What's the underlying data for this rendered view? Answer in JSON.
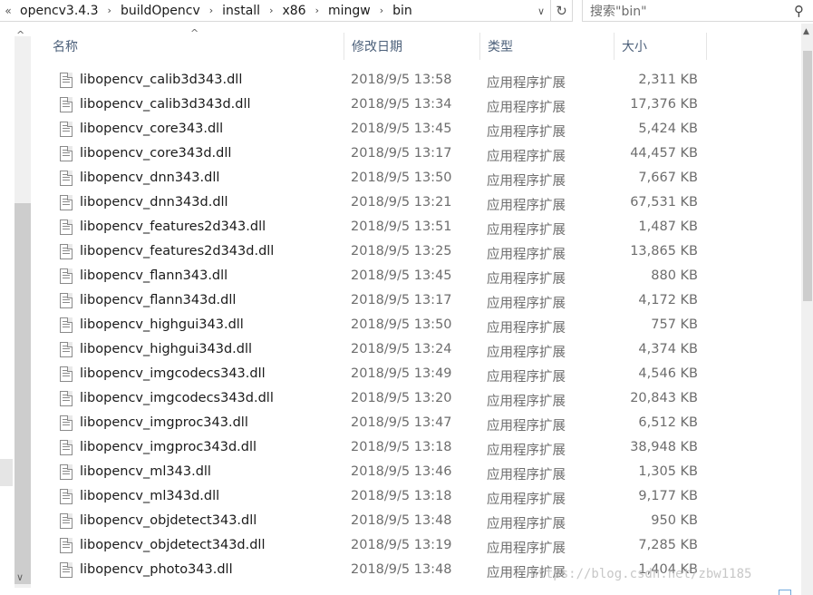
{
  "address": {
    "crumbs": [
      "opencv3.4.3",
      "buildOpencv",
      "install",
      "x86",
      "mingw",
      "bin"
    ],
    "lead_glyph": "«",
    "separator": "›",
    "dropdown_glyph": "∨",
    "refresh_glyph": "↻"
  },
  "search": {
    "placeholder": "搜索\"bin\"",
    "icon": "search-icon"
  },
  "columns": {
    "name": "名称",
    "date": "修改日期",
    "type": "类型",
    "size": "大小",
    "sort_glyph": "^"
  },
  "files": [
    {
      "name": "libopencv_calib3d343.dll",
      "date": "2018/9/5 13:58",
      "type": "应用程序扩展",
      "size": "2,311 KB"
    },
    {
      "name": "libopencv_calib3d343d.dll",
      "date": "2018/9/5 13:34",
      "type": "应用程序扩展",
      "size": "17,376 KB"
    },
    {
      "name": "libopencv_core343.dll",
      "date": "2018/9/5 13:45",
      "type": "应用程序扩展",
      "size": "5,424 KB"
    },
    {
      "name": "libopencv_core343d.dll",
      "date": "2018/9/5 13:17",
      "type": "应用程序扩展",
      "size": "44,457 KB"
    },
    {
      "name": "libopencv_dnn343.dll",
      "date": "2018/9/5 13:50",
      "type": "应用程序扩展",
      "size": "7,667 KB"
    },
    {
      "name": "libopencv_dnn343d.dll",
      "date": "2018/9/5 13:21",
      "type": "应用程序扩展",
      "size": "67,531 KB"
    },
    {
      "name": "libopencv_features2d343.dll",
      "date": "2018/9/5 13:51",
      "type": "应用程序扩展",
      "size": "1,487 KB"
    },
    {
      "name": "libopencv_features2d343d.dll",
      "date": "2018/9/5 13:25",
      "type": "应用程序扩展",
      "size": "13,865 KB"
    },
    {
      "name": "libopencv_flann343.dll",
      "date": "2018/9/5 13:45",
      "type": "应用程序扩展",
      "size": "880 KB"
    },
    {
      "name": "libopencv_flann343d.dll",
      "date": "2018/9/5 13:17",
      "type": "应用程序扩展",
      "size": "4,172 KB"
    },
    {
      "name": "libopencv_highgui343.dll",
      "date": "2018/9/5 13:50",
      "type": "应用程序扩展",
      "size": "757 KB"
    },
    {
      "name": "libopencv_highgui343d.dll",
      "date": "2018/9/5 13:24",
      "type": "应用程序扩展",
      "size": "4,374 KB"
    },
    {
      "name": "libopencv_imgcodecs343.dll",
      "date": "2018/9/5 13:49",
      "type": "应用程序扩展",
      "size": "4,546 KB"
    },
    {
      "name": "libopencv_imgcodecs343d.dll",
      "date": "2018/9/5 13:20",
      "type": "应用程序扩展",
      "size": "20,843 KB"
    },
    {
      "name": "libopencv_imgproc343.dll",
      "date": "2018/9/5 13:47",
      "type": "应用程序扩展",
      "size": "6,512 KB"
    },
    {
      "name": "libopencv_imgproc343d.dll",
      "date": "2018/9/5 13:18",
      "type": "应用程序扩展",
      "size": "38,948 KB"
    },
    {
      "name": "libopencv_ml343.dll",
      "date": "2018/9/5 13:46",
      "type": "应用程序扩展",
      "size": "1,305 KB"
    },
    {
      "name": "libopencv_ml343d.dll",
      "date": "2018/9/5 13:18",
      "type": "应用程序扩展",
      "size": "9,177 KB"
    },
    {
      "name": "libopencv_objdetect343.dll",
      "date": "2018/9/5 13:48",
      "type": "应用程序扩展",
      "size": "950 KB"
    },
    {
      "name": "libopencv_objdetect343d.dll",
      "date": "2018/9/5 13:19",
      "type": "应用程序扩展",
      "size": "7,285 KB"
    },
    {
      "name": "libopencv_photo343.dll",
      "date": "2018/9/5 13:48",
      "type": "应用程序扩展",
      "size": "1,404 KB"
    }
  ],
  "file_icon": "dll-file-icon",
  "watermark": "https://blog.csdn.net/zbw1185",
  "colors": {
    "header_text": "#4c607a",
    "meta_text": "#6d6d6d",
    "scroll_thumb": "#cdcdcd"
  }
}
